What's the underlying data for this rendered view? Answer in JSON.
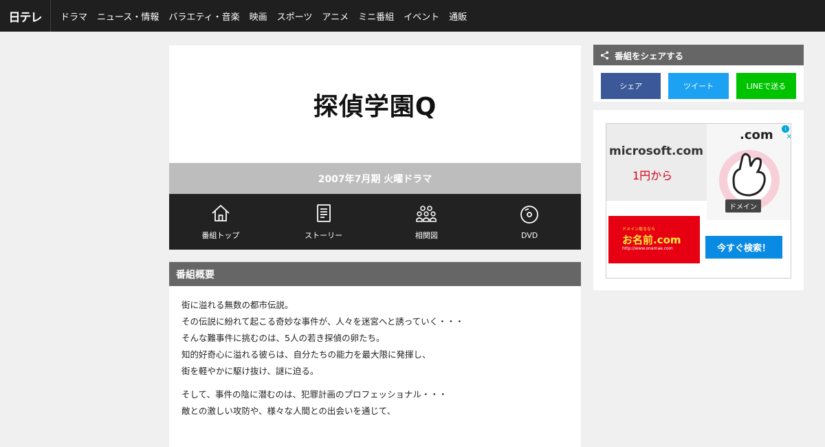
{
  "header": {
    "logo": "日テレ",
    "nav": [
      "ドラマ",
      "ニュース・情報",
      "バラエティ・音楽",
      "映画",
      "スポーツ",
      "アニメ",
      "ミニ番組",
      "イベント",
      "通販"
    ]
  },
  "program": {
    "title": "探偵学園Q",
    "season": "2007年7月期 火曜ドラマ",
    "nav": [
      {
        "label": "番組トップ",
        "icon": "home-icon"
      },
      {
        "label": "ストーリー",
        "icon": "document-icon"
      },
      {
        "label": "相関図",
        "icon": "people-icon"
      },
      {
        "label": "DVD",
        "icon": "disc-icon"
      }
    ]
  },
  "overview": {
    "heading": "番組概要",
    "para1": [
      "街に溢れる無数の都市伝説。",
      "その伝説に紛れて起こる奇妙な事件が、人々を迷宮へと誘っていく・・・",
      "そんな難事件に挑むのは、5人の若き探偵の卵たち。",
      "知的好奇心に溢れる彼らは、自分たちの能力を最大限に発揮し、",
      "街を軽やかに駆け抜け、謎に迫る。"
    ],
    "para2": [
      "そして、事件の陰に潜むのは、犯罪計画のプロフェッショナル・・・",
      "敵との激しい攻防や、様々な人間との出会いを通じて、"
    ]
  },
  "share": {
    "heading": "番組をシェアする",
    "facebook": "シェア",
    "twitter": "ツイート",
    "line": "LINEで送る",
    "colors": {
      "facebook": "#3b5998",
      "twitter": "#1da1f2",
      "line": "#00c300"
    }
  },
  "ad": {
    "domain_text": "microsoft.com",
    "price": "1円から",
    "dotcom": ".com",
    "badge": "ドメイン",
    "brand_small": "ドメイン取るなら",
    "brand": "お名前.com",
    "brand_url": "http://www.onamae.com",
    "cta": "今すぐ検索！"
  }
}
